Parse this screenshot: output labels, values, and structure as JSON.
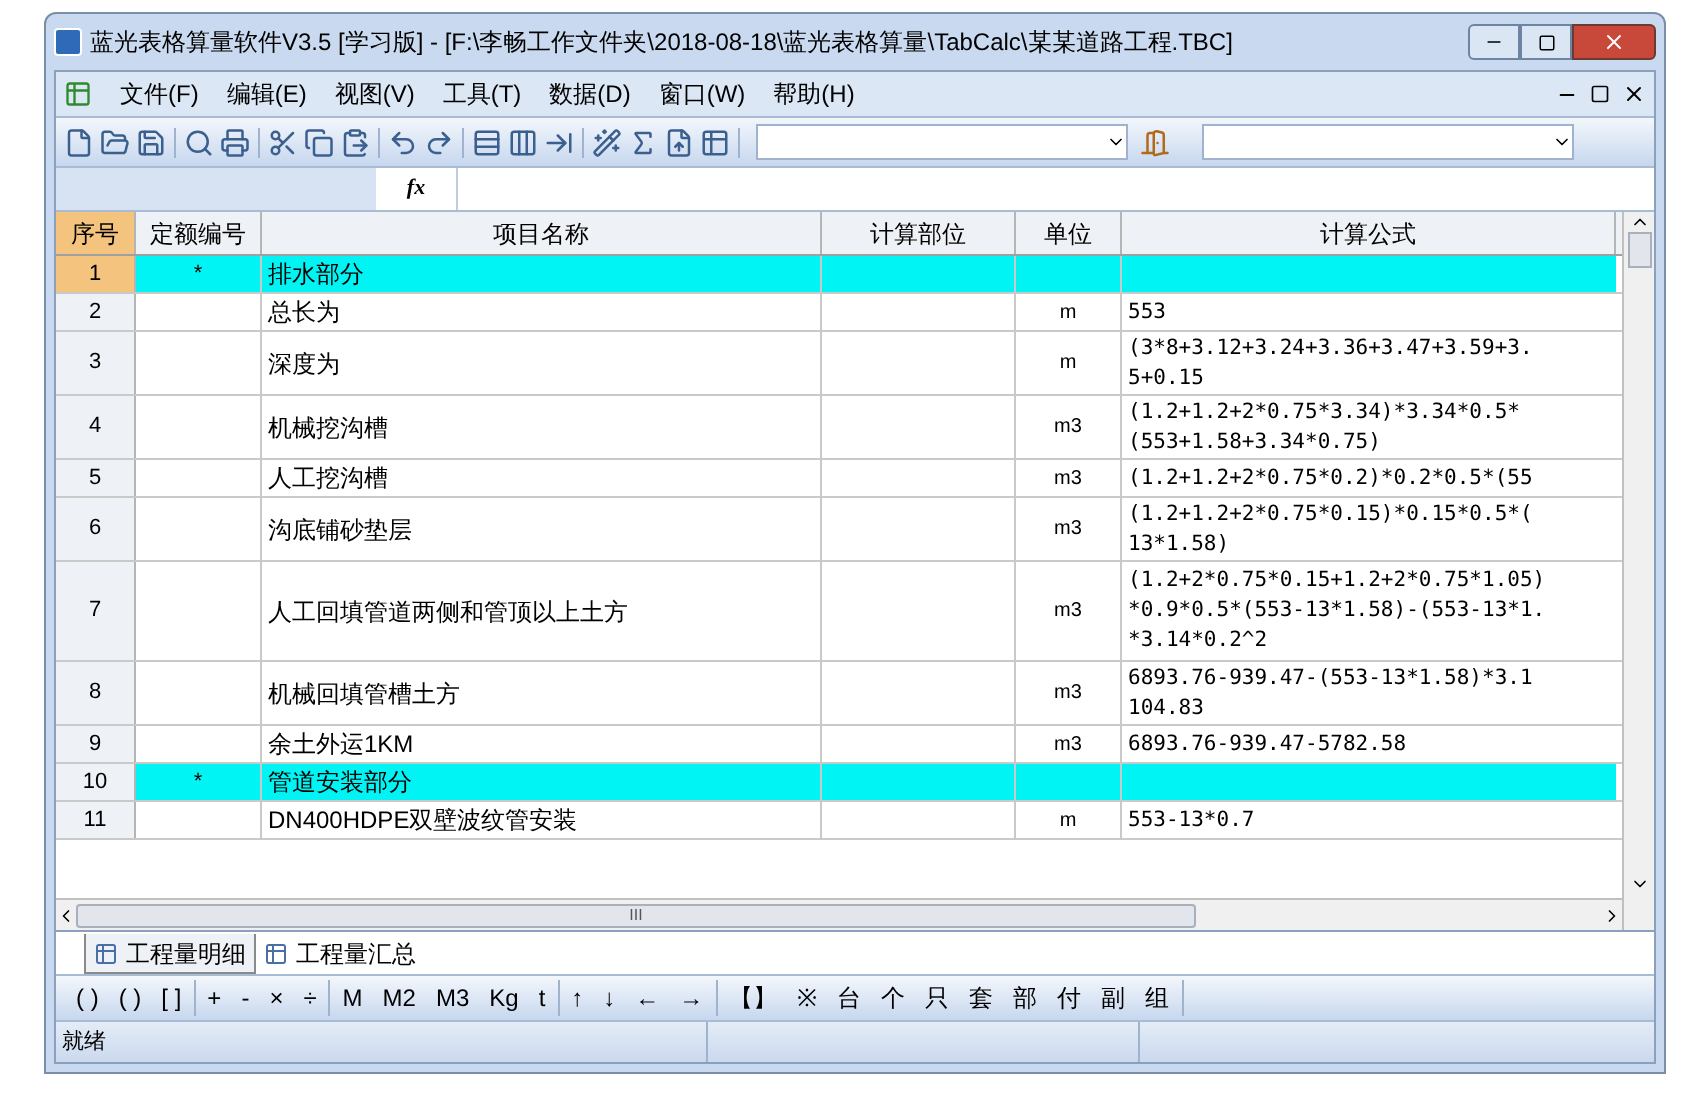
{
  "window": {
    "title": "蓝光表格算量软件V3.5 [学习版] - [F:\\李畅工作文件夹\\2018-08-18\\蓝光表格算量\\TabCalc\\某某道路工程.TBC]"
  },
  "menu": [
    "文件(F)",
    "编辑(E)",
    "视图(V)",
    "工具(T)",
    "数据(D)",
    "窗口(W)",
    "帮助(H)"
  ],
  "formula_bar": {
    "fx": "fx"
  },
  "table": {
    "columns": [
      "序号",
      "定额编号",
      "项目名称",
      "计算部位",
      "单位",
      "计算公式"
    ],
    "rows": [
      {
        "kind": "section",
        "selected": true,
        "no": "1",
        "code": "*",
        "name": "排水部分",
        "unit": "",
        "formula": []
      },
      {
        "kind": "item",
        "selected": false,
        "no": "2",
        "code": "",
        "name": "总长为",
        "unit": "m",
        "formula": [
          "553"
        ]
      },
      {
        "kind": "item",
        "selected": false,
        "no": "3",
        "code": "",
        "name": "深度为",
        "unit": "m",
        "formula": [
          "(3*8+3.12+3.24+3.36+3.47+3.59+3.",
          "5+0.15"
        ]
      },
      {
        "kind": "item",
        "selected": false,
        "no": "4",
        "code": "",
        "name": "机械挖沟槽",
        "unit": "m3",
        "formula": [
          "(1.2+1.2+2*0.75*3.34)*3.34*0.5*",
          "(553+1.58+3.34*0.75)"
        ]
      },
      {
        "kind": "item",
        "selected": false,
        "no": "5",
        "code": "",
        "name": "人工挖沟槽",
        "unit": "m3",
        "formula": [
          "(1.2+1.2+2*0.75*0.2)*0.2*0.5*(55"
        ]
      },
      {
        "kind": "item",
        "selected": false,
        "no": "6",
        "code": "",
        "name": "沟底铺砂垫层",
        "unit": "m3",
        "formula": [
          "(1.2+1.2+2*0.75*0.15)*0.15*0.5*(",
          "13*1.58)"
        ]
      },
      {
        "kind": "item",
        "selected": false,
        "no": "7",
        "code": "",
        "name": "人工回填管道两侧和管顶以上土方",
        "unit": "m3",
        "formula": [
          "(1.2+2*0.75*0.15+1.2+2*0.75*1.05)",
          "*0.9*0.5*(553-13*1.58)-(553-13*1.",
          "*3.14*0.2^2"
        ]
      },
      {
        "kind": "item",
        "selected": false,
        "no": "8",
        "code": "",
        "name": "机械回填管槽土方",
        "unit": "m3",
        "formula": [
          "6893.76-939.47-(553-13*1.58)*3.1",
          "104.83"
        ]
      },
      {
        "kind": "item",
        "selected": false,
        "no": "9",
        "code": "",
        "name": "余土外运1KM",
        "unit": "m3",
        "formula": [
          "6893.76-939.47-5782.58"
        ]
      },
      {
        "kind": "section",
        "selected": false,
        "no": "10",
        "code": "*",
        "name": "管道安装部分",
        "unit": "",
        "formula": []
      },
      {
        "kind": "item",
        "selected": false,
        "no": "11",
        "code": "",
        "name": "DN400HDPE双壁波纹管安装",
        "unit": "m",
        "formula": [
          "553-13*0.7"
        ]
      }
    ]
  },
  "scrollbar_h": {
    "grip": "III"
  },
  "tabs": [
    {
      "label": "工程量明细",
      "selected": true
    },
    {
      "label": "工程量汇总",
      "selected": false
    }
  ],
  "symbols": [
    [
      "(  )",
      "( )",
      "[ ]"
    ],
    [
      "+",
      "-",
      "×",
      "÷"
    ],
    [
      "M",
      "M2",
      "M3",
      "Kg",
      "t"
    ],
    [
      "↑",
      "↓",
      "←",
      "→"
    ],
    [
      "【】",
      "※",
      "台",
      "个",
      "只",
      "套",
      "部",
      "付",
      "副",
      "组"
    ]
  ],
  "status_bar": [
    "就绪"
  ]
}
